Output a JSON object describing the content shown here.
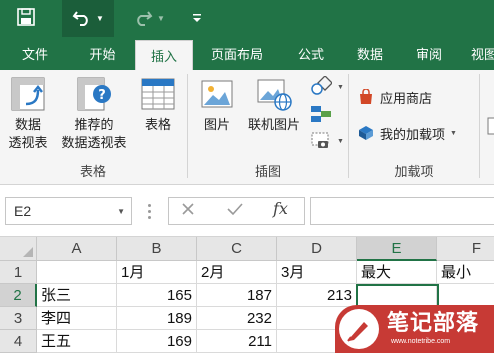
{
  "quick_access": {
    "icons": [
      "save-icon",
      "undo-icon",
      "redo-icon",
      "customize-icon"
    ]
  },
  "tabs": [
    {
      "label": "文件",
      "active": false
    },
    {
      "label": "开始",
      "active": false
    },
    {
      "label": "插入",
      "active": true
    },
    {
      "label": "页面布局",
      "active": false
    },
    {
      "label": "公式",
      "active": false
    },
    {
      "label": "数据",
      "active": false
    },
    {
      "label": "审阅",
      "active": false
    },
    {
      "label": "视图",
      "active": false
    }
  ],
  "ribbon": {
    "tables_group": {
      "pivot_line1": "数据",
      "pivot_line2": "透视表",
      "recommended_line1": "推荐的",
      "recommended_line2": "数据透视表",
      "table": "表格",
      "group_label": "表格"
    },
    "illustrations_group": {
      "pictures": "图片",
      "online_pictures": "联机图片",
      "group_label": "插图"
    },
    "addins_group": {
      "store": "应用商店",
      "my_addins": "我的加载项",
      "group_label": "加载项"
    }
  },
  "formula_bar": {
    "name_box": "E2",
    "formula": ""
  },
  "sheet": {
    "columns": [
      "A",
      "B",
      "C",
      "D",
      "E",
      "F"
    ],
    "rows": [
      {
        "num": "1",
        "cells": [
          "",
          "1月",
          "2月",
          "3月",
          "最大",
          "最小"
        ]
      },
      {
        "num": "2",
        "cells": [
          "张三",
          "165",
          "187",
          "213",
          "",
          ""
        ]
      },
      {
        "num": "3",
        "cells": [
          "李四",
          "189",
          "232",
          "1",
          "",
          ""
        ]
      },
      {
        "num": "4",
        "cells": [
          "王五",
          "169",
          "211",
          "2",
          "",
          ""
        ]
      }
    ],
    "active_cell": "E2"
  },
  "watermark": {
    "title": "笔记部落",
    "url": "www.notetribe.com"
  },
  "colors": {
    "accent": "#217346",
    "watermark": "#c73a35"
  }
}
